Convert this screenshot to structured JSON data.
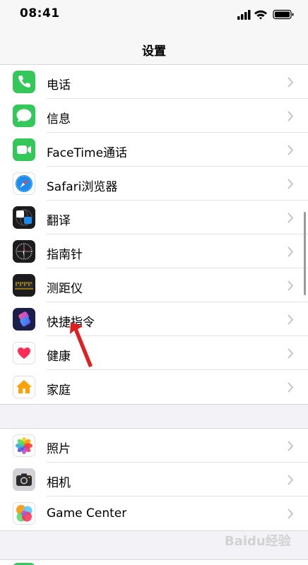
{
  "status_bar": {
    "time": "08:41"
  },
  "nav": {
    "title": "设置"
  },
  "group1": [
    {
      "label": "电话",
      "icon": "phone-icon"
    },
    {
      "label": "信息",
      "icon": "messages-icon"
    },
    {
      "label": "FaceTime通话",
      "icon": "facetime-icon"
    },
    {
      "label": "Safari浏览器",
      "icon": "safari-icon"
    },
    {
      "label": "翻译",
      "icon": "translate-icon"
    },
    {
      "label": "指南针",
      "icon": "compass-icon"
    },
    {
      "label": "测距仪",
      "icon": "measure-icon"
    },
    {
      "label": "快捷指令",
      "icon": "shortcuts-icon"
    },
    {
      "label": "健康",
      "icon": "health-icon"
    },
    {
      "label": "家庭",
      "icon": "home-icon"
    }
  ],
  "group2": [
    {
      "label": "照片",
      "icon": "photos-icon"
    },
    {
      "label": "相机",
      "icon": "camera-icon"
    },
    {
      "label": "Game Center",
      "icon": "game-center-icon"
    }
  ],
  "colors": {
    "background": "#f2f2f7",
    "chevron": "#c4c4c6",
    "annotation_arrow": "#e02020"
  },
  "watermark": "Baidu经验"
}
